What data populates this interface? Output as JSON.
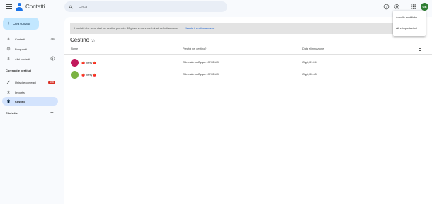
{
  "app": {
    "title": "Contatti"
  },
  "search": {
    "placeholder": "Cerca"
  },
  "header": {
    "avatar_initials": "GB"
  },
  "sidebar": {
    "create_label": "Crea contatto",
    "items": [
      {
        "label": "Contatti",
        "count": "481",
        "icon": "person-icon"
      },
      {
        "label": "Frequenti",
        "icon": "history-icon"
      },
      {
        "label": "Altri contatti",
        "icon": "person-add-icon"
      }
    ],
    "section_fix": "Correggi e gestisci",
    "manage_items": [
      {
        "label": "Unisci e correggi",
        "badge": "156",
        "icon": "wand-icon"
      },
      {
        "label": "Importa",
        "icon": "download-icon"
      },
      {
        "label": "Cestino",
        "icon": "trash-icon"
      }
    ],
    "labels_section": "Etichette",
    "add_label": "+"
  },
  "main": {
    "banner_text": "I contatti che sono stati nel cestino per oltre 30 giorni verranno eliminati definitivamente",
    "banner_link": "Svuota il cestino adesso",
    "title": "Cestino",
    "title_count": "(2)",
    "columns": [
      "Nome",
      "Perché nel cestino?",
      "Data eliminazione"
    ],
    "rows": [
      {
        "name": "🍅 berry 🍅",
        "reason": "Eliminato su Oppo - CPH2649",
        "date": "Oggi, 01:24",
        "avatar_color": "#c2185b"
      },
      {
        "name": "🍅 berry 🍅",
        "reason": "Eliminato su Oppo - CPH2649",
        "date": "Oggi, 00:48",
        "avatar_color": "#7cb342"
      }
    ]
  },
  "menu": {
    "items": [
      "Annulla modifiche",
      "Altre impostazioni"
    ]
  },
  "colors": {
    "accent": "#0b57d0",
    "create_bg": "#c2e7ff",
    "active_bg": "#d3e3fd",
    "badge": "#d93025"
  }
}
